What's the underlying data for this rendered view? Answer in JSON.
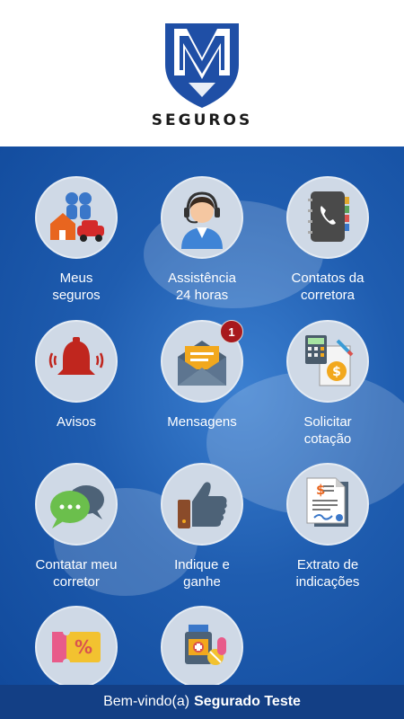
{
  "brand": {
    "name": "SEGUROS"
  },
  "colors": {
    "shield": "#1f4fa6",
    "background": "#1f5db0",
    "footer": "#133f85",
    "badge": "#a8191d"
  },
  "tiles": [
    {
      "label": "Meus\nseguros",
      "icon": "family-house-car-icon"
    },
    {
      "label": "Assistência\n24 horas",
      "icon": "support-agent-icon"
    },
    {
      "label": "Contatos da\ncorretora",
      "icon": "phone-book-icon"
    },
    {
      "label": "Avisos",
      "icon": "bell-icon"
    },
    {
      "label": "Mensagens",
      "icon": "envelope-icon",
      "badge": "1"
    },
    {
      "label": "Solicitar\ncotação",
      "icon": "calculator-money-icon"
    },
    {
      "label": "Contatar meu\ncorretor",
      "icon": "chat-bubbles-icon"
    },
    {
      "label": "Indique e\nganhe",
      "icon": "thumbs-up-icon"
    },
    {
      "label": "Extrato de\nindicações",
      "icon": "statement-document-icon"
    },
    {
      "label": "",
      "icon": "discount-ticket-icon"
    },
    {
      "label": "",
      "icon": "medicine-icon"
    }
  ],
  "footer": {
    "greeting": "Bem-vindo(a)",
    "user_name": "Segurado Teste"
  }
}
